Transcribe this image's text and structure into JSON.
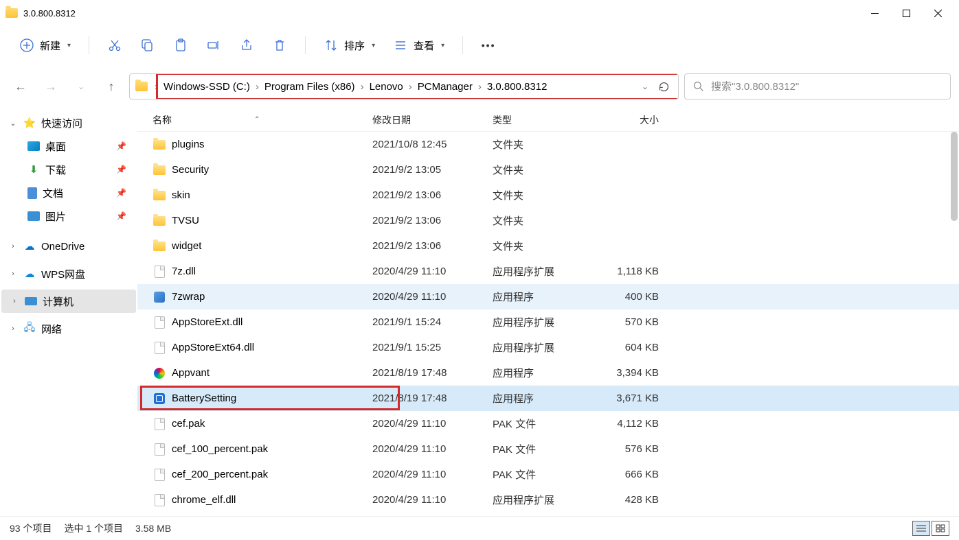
{
  "window": {
    "title": "3.0.800.8312"
  },
  "toolbar": {
    "new_label": "新建",
    "sort_label": "排序",
    "view_label": "查看"
  },
  "breadcrumb": {
    "items": [
      "Windows-SSD (C:)",
      "Program Files (x86)",
      "Lenovo",
      "PCManager",
      "3.0.800.8312"
    ]
  },
  "search": {
    "placeholder": "搜索\"3.0.800.8312\""
  },
  "sidebar": {
    "quick_access": "快速访问",
    "desktop": "桌面",
    "downloads": "下载",
    "documents": "文档",
    "pictures": "图片",
    "onedrive": "OneDrive",
    "wps": "WPS网盘",
    "computer": "计算机",
    "network": "网络"
  },
  "columns": {
    "name": "名称",
    "date": "修改日期",
    "type": "类型",
    "size": "大小"
  },
  "files": [
    {
      "name": "plugins",
      "date": "2021/10/8 12:45",
      "type": "文件夹",
      "size": "",
      "icon": "folder"
    },
    {
      "name": "Security",
      "date": "2021/9/2 13:05",
      "type": "文件夹",
      "size": "",
      "icon": "folder"
    },
    {
      "name": "skin",
      "date": "2021/9/2 13:06",
      "type": "文件夹",
      "size": "",
      "icon": "folder"
    },
    {
      "name": "TVSU",
      "date": "2021/9/2 13:06",
      "type": "文件夹",
      "size": "",
      "icon": "folder"
    },
    {
      "name": "widget",
      "date": "2021/9/2 13:06",
      "type": "文件夹",
      "size": "",
      "icon": "folder"
    },
    {
      "name": "7z.dll",
      "date": "2020/4/29 11:10",
      "type": "应用程序扩展",
      "size": "1,118 KB",
      "icon": "dll"
    },
    {
      "name": "7zwrap",
      "date": "2020/4/29 11:10",
      "type": "应用程序",
      "size": "400 KB",
      "icon": "exe-blue",
      "related": true
    },
    {
      "name": "AppStoreExt.dll",
      "date": "2021/9/1 15:24",
      "type": "应用程序扩展",
      "size": "570 KB",
      "icon": "dll"
    },
    {
      "name": "AppStoreExt64.dll",
      "date": "2021/9/1 15:25",
      "type": "应用程序扩展",
      "size": "604 KB",
      "icon": "dll"
    },
    {
      "name": "Appvant",
      "date": "2021/8/19 17:48",
      "type": "应用程序",
      "size": "3,394 KB",
      "icon": "exe-color"
    },
    {
      "name": "BatterySetting",
      "date": "2021/8/19 17:48",
      "type": "应用程序",
      "size": "3,671 KB",
      "icon": "exe-blue2",
      "selected": true,
      "highlighted": true
    },
    {
      "name": "cef.pak",
      "date": "2020/4/29 11:10",
      "type": "PAK 文件",
      "size": "4,112 KB",
      "icon": "file"
    },
    {
      "name": "cef_100_percent.pak",
      "date": "2020/4/29 11:10",
      "type": "PAK 文件",
      "size": "576 KB",
      "icon": "file"
    },
    {
      "name": "cef_200_percent.pak",
      "date": "2020/4/29 11:10",
      "type": "PAK 文件",
      "size": "666 KB",
      "icon": "file"
    },
    {
      "name": "chrome_elf.dll",
      "date": "2020/4/29 11:10",
      "type": "应用程序扩展",
      "size": "428 KB",
      "icon": "dll"
    }
  ],
  "status": {
    "count_label": "93 个项目",
    "selection_label": "选中 1 个项目",
    "size_label": "3.58 MB"
  }
}
